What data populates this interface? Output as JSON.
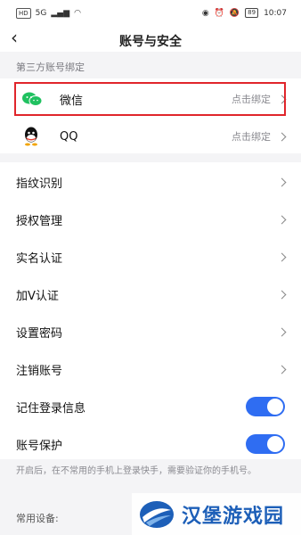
{
  "status_bar": {
    "sim": "HD",
    "signal": "5G",
    "battery": "89",
    "time": "10:07"
  },
  "nav": {
    "title": "账号与安全"
  },
  "third_party": {
    "section_label": "第三方账号绑定",
    "items": [
      {
        "label": "微信",
        "hint": "点击绑定",
        "icon": "wechat-icon"
      },
      {
        "label": "QQ",
        "hint": "点击绑定",
        "icon": "qq-icon"
      }
    ]
  },
  "settings": {
    "items": [
      {
        "label": "指纹识别"
      },
      {
        "label": "授权管理"
      },
      {
        "label": "实名认证"
      },
      {
        "label": "加V认证"
      },
      {
        "label": "设置密码"
      },
      {
        "label": "注销账号"
      }
    ],
    "toggles": [
      {
        "label": "记住登录信息",
        "on": true
      },
      {
        "label": "账号保护",
        "on": true
      }
    ],
    "note": "开启后，在不常用的手机上登录快手，需要验证你的手机号。"
  },
  "devices": {
    "section_label": "常用设备:"
  },
  "watermark": {
    "text": "汉堡游戏园"
  },
  "colors": {
    "accent": "#2f6df2",
    "highlight": "#e0252b",
    "wechat": "#20c160"
  }
}
